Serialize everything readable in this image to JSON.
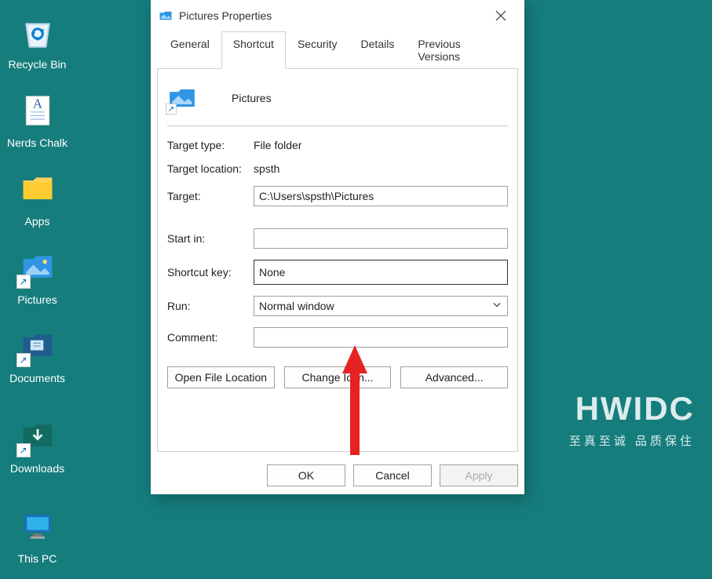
{
  "desktop": {
    "items": [
      {
        "label": "Recycle Bin"
      },
      {
        "label": "Nerds Chalk"
      },
      {
        "label": "Apps"
      },
      {
        "label": "Pictures"
      },
      {
        "label": "Documents"
      },
      {
        "label": "Downloads"
      },
      {
        "label": "This PC"
      }
    ]
  },
  "watermark": {
    "line1": "HWIDC",
    "line2": "至真至诚 品质保住"
  },
  "dialog": {
    "title": "Pictures Properties",
    "tabs": [
      "General",
      "Shortcut",
      "Security",
      "Details",
      "Previous Versions"
    ],
    "active_tab": "Shortcut",
    "shortcut_name": "Pictures",
    "fields": {
      "target_type_label": "Target type:",
      "target_type_value": "File folder",
      "target_location_label": "Target location:",
      "target_location_value": "spsth",
      "target_label": "Target:",
      "target_value": "C:\\Users\\spsth\\Pictures",
      "start_in_label": "Start in:",
      "start_in_value": "",
      "shortcut_key_label": "Shortcut key:",
      "shortcut_key_value": "None",
      "run_label": "Run:",
      "run_value": "Normal window",
      "comment_label": "Comment:",
      "comment_value": ""
    },
    "buttons": {
      "open_file_location": "Open File Location",
      "change_icon": "Change Icon...",
      "advanced": "Advanced...",
      "ok": "OK",
      "cancel": "Cancel",
      "apply": "Apply"
    }
  }
}
